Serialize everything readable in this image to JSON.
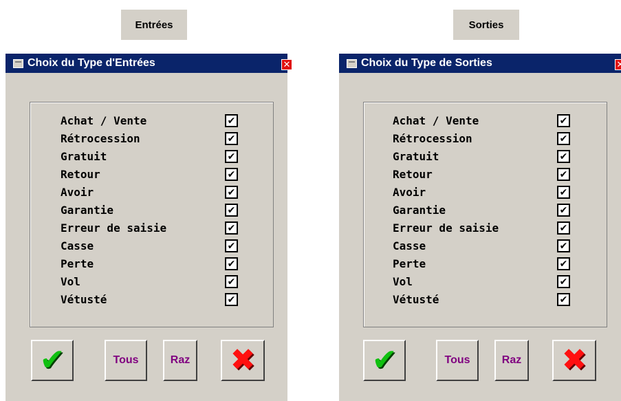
{
  "panels": [
    {
      "tab_label": "Entrées",
      "window_title": "Choix du Type d'Entrées",
      "close_glyph": "✕",
      "options": [
        {
          "label": "Achat / Vente",
          "checked": true,
          "mark": "✔"
        },
        {
          "label": "Rétrocession",
          "checked": true,
          "mark": "✔"
        },
        {
          "label": "Gratuit",
          "checked": true,
          "mark": "✔"
        },
        {
          "label": "Retour",
          "checked": true,
          "mark": "✔"
        },
        {
          "label": "Avoir",
          "checked": true,
          "mark": "✔"
        },
        {
          "label": "Garantie",
          "checked": true,
          "mark": "✔"
        },
        {
          "label": "Erreur de saisie",
          "checked": true,
          "mark": "✔"
        },
        {
          "label": "Casse",
          "checked": true,
          "mark": "✔"
        },
        {
          "label": "Perte",
          "checked": true,
          "mark": "✔"
        },
        {
          "label": "Vol",
          "checked": true,
          "mark": "✔"
        },
        {
          "label": "Vétusté",
          "checked": true,
          "mark": "✔"
        }
      ],
      "buttons": {
        "ok_icon": "✔",
        "all_label": "Tous",
        "reset_label": "Raz",
        "cancel_icon": "✖"
      }
    },
    {
      "tab_label": "Sorties",
      "window_title": "Choix du Type de Sorties",
      "close_glyph": "✕",
      "options": [
        {
          "label": "Achat / Vente",
          "checked": true,
          "mark": "✔"
        },
        {
          "label": "Rétrocession",
          "checked": true,
          "mark": "✔"
        },
        {
          "label": "Gratuit",
          "checked": true,
          "mark": "✔"
        },
        {
          "label": "Retour",
          "checked": true,
          "mark": "✔"
        },
        {
          "label": "Avoir",
          "checked": true,
          "mark": "✔"
        },
        {
          "label": "Garantie",
          "checked": true,
          "mark": "✔"
        },
        {
          "label": "Erreur de saisie",
          "checked": true,
          "mark": "✔"
        },
        {
          "label": "Casse",
          "checked": true,
          "mark": "✔"
        },
        {
          "label": "Perte",
          "checked": true,
          "mark": "✔"
        },
        {
          "label": "Vol",
          "checked": true,
          "mark": "✔"
        },
        {
          "label": "Vétusté",
          "checked": true,
          "mark": "✔"
        }
      ],
      "buttons": {
        "ok_icon": "✔",
        "all_label": "Tous",
        "reset_label": "Raz",
        "cancel_icon": "✖"
      }
    }
  ],
  "colors": {
    "titlebar": "#0a246a",
    "dialog_bg": "#d4d0c8",
    "button_text": "#800080",
    "ok_icon": "#10c010",
    "cancel_icon": "#ff1010",
    "close_button": "#e01010"
  },
  "icons": {
    "window": "window-icon",
    "close": "close-icon",
    "ok": "checkmark-icon",
    "cancel": "cross-icon"
  }
}
